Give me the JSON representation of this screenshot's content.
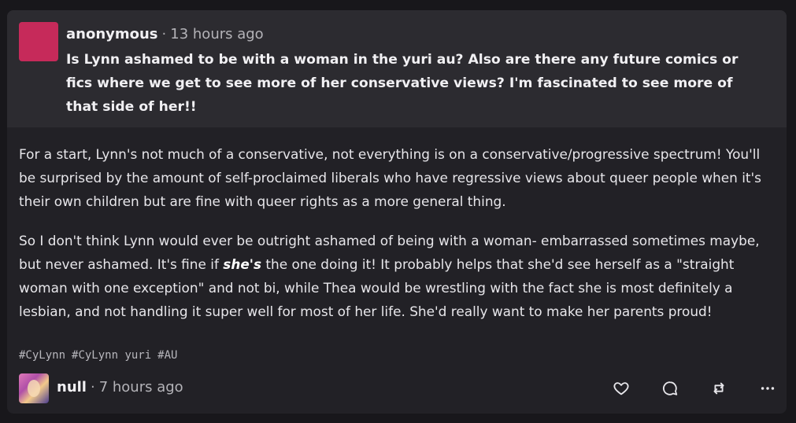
{
  "ask": {
    "author": "anonymous",
    "separator": "·",
    "time": "13 hours ago",
    "question": "Is Lynn ashamed to be with a woman in the yuri au? Also are there any future comics or fics where we get to see more of her conservative views? I'm fascinated to see more of that side of her!!"
  },
  "answer": {
    "p1": "For a start, Lynn's not much of a conservative, not everything is on a conservative/progressive spectrum! You'll be surprised by the amount of self-proclaimed liberals who have regressive views about queer people when it's their own children but are fine with queer rights as a more general thing.",
    "p2_before": "So I don't think Lynn would ever be outright ashamed of being with a woman- embarrassed sometimes maybe, but never ashamed. It's fine if ",
    "p2_emphasis": "she's",
    "p2_after": " the one doing it! It probably helps that she'd see herself as a \"straight woman with one exception\" and not bi, while Thea would be wrestling with the fact she is most definitely a lesbian, and not handling it super well for most of her life. She'd really want to make her parents proud!"
  },
  "tags": [
    "#CyLynn",
    "#CyLynn yuri",
    "#AU"
  ],
  "reblog": {
    "author": "null",
    "separator": "·",
    "time": "7 hours ago"
  },
  "actions": {
    "like_icon": "heart-icon",
    "comment_icon": "comment-icon",
    "reblog_icon": "reblog-icon",
    "more_icon": "more-icon"
  },
  "colors": {
    "background": "#18171b",
    "card": "#222126",
    "ask_panel": "#2c2b30",
    "ask_avatar": "#c62a5a"
  }
}
